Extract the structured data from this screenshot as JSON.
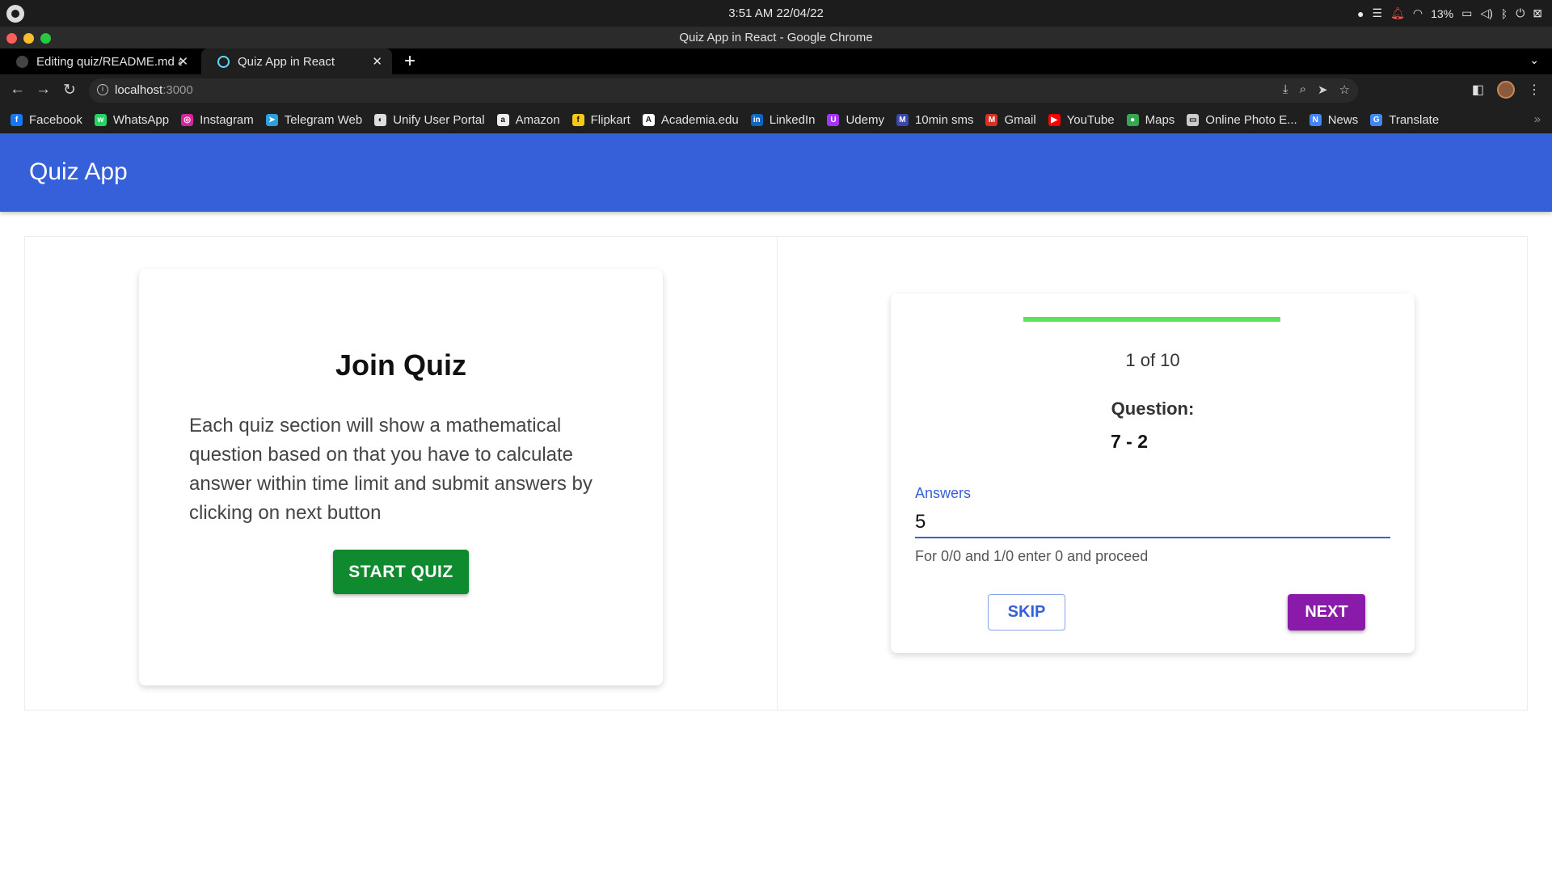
{
  "os": {
    "clock": "3:51 AM  22/04/22",
    "battery": "13%"
  },
  "window": {
    "title": "Quiz App in React - Google Chrome"
  },
  "tabs": [
    {
      "label": "Editing quiz/README.md at main",
      "icon": "github-icon"
    },
    {
      "label": "Quiz App in React",
      "icon": "react-icon"
    }
  ],
  "address": {
    "host": "localhost",
    "port": ":3000"
  },
  "bookmarks": [
    {
      "label": "Facebook",
      "icon": "facebook-icon",
      "color": "#1877f2",
      "glyph": "f"
    },
    {
      "label": "WhatsApp",
      "icon": "whatsapp-icon",
      "color": "#25d366",
      "glyph": "w"
    },
    {
      "label": "Instagram",
      "icon": "instagram-icon",
      "color": "#d6249f",
      "glyph": "◎"
    },
    {
      "label": "Telegram Web",
      "icon": "telegram-icon",
      "color": "#2aa1da",
      "glyph": "➤"
    },
    {
      "label": "Unify User Portal",
      "icon": "unify-icon",
      "color": "#dddddd",
      "glyph": "◐"
    },
    {
      "label": "Amazon",
      "icon": "amazon-icon",
      "color": "#eeeeee",
      "glyph": "a"
    },
    {
      "label": "Flipkart",
      "icon": "flipkart-icon",
      "color": "#f6c915",
      "glyph": "f"
    },
    {
      "label": "Academia.edu",
      "icon": "academia-icon",
      "color": "#ffffff",
      "glyph": "A"
    },
    {
      "label": "LinkedIn",
      "icon": "linkedin-icon",
      "color": "#0a66c2",
      "glyph": "in"
    },
    {
      "label": "Udemy",
      "icon": "udemy-icon",
      "color": "#a435f0",
      "glyph": "U"
    },
    {
      "label": "10min sms",
      "icon": "sms-icon",
      "color": "#3949ab",
      "glyph": "M"
    },
    {
      "label": "Gmail",
      "icon": "gmail-icon",
      "color": "#d93025",
      "glyph": "M"
    },
    {
      "label": "YouTube",
      "icon": "youtube-icon",
      "color": "#ff0000",
      "glyph": "▶"
    },
    {
      "label": "Maps",
      "icon": "maps-icon",
      "color": "#34a853",
      "glyph": "●"
    },
    {
      "label": "Online Photo E...",
      "icon": "photo-editor-icon",
      "color": "#cccccc",
      "glyph": "▭"
    },
    {
      "label": "News",
      "icon": "news-icon",
      "color": "#4285f4",
      "glyph": "N"
    },
    {
      "label": "Translate",
      "icon": "translate-icon",
      "color": "#4285f4",
      "glyph": "G"
    }
  ],
  "app": {
    "title": "Quiz App",
    "header_color": "#3660d9"
  },
  "join": {
    "title": "Join Quiz",
    "description": "Each quiz section will show a mathematical question based on that you have to calculate answer within time limit and submit answers by clicking on next button",
    "start_label": "START QUIZ"
  },
  "quiz": {
    "progress": 1.0,
    "counter": "1 of 10",
    "question_label": "Question:",
    "question": "7 - 2",
    "answer_label": "Answers",
    "answer_value": "5",
    "helper": "For 0/0 and 1/0 enter 0 and proceed",
    "skip_label": "SKIP",
    "next_label": "NEXT"
  }
}
